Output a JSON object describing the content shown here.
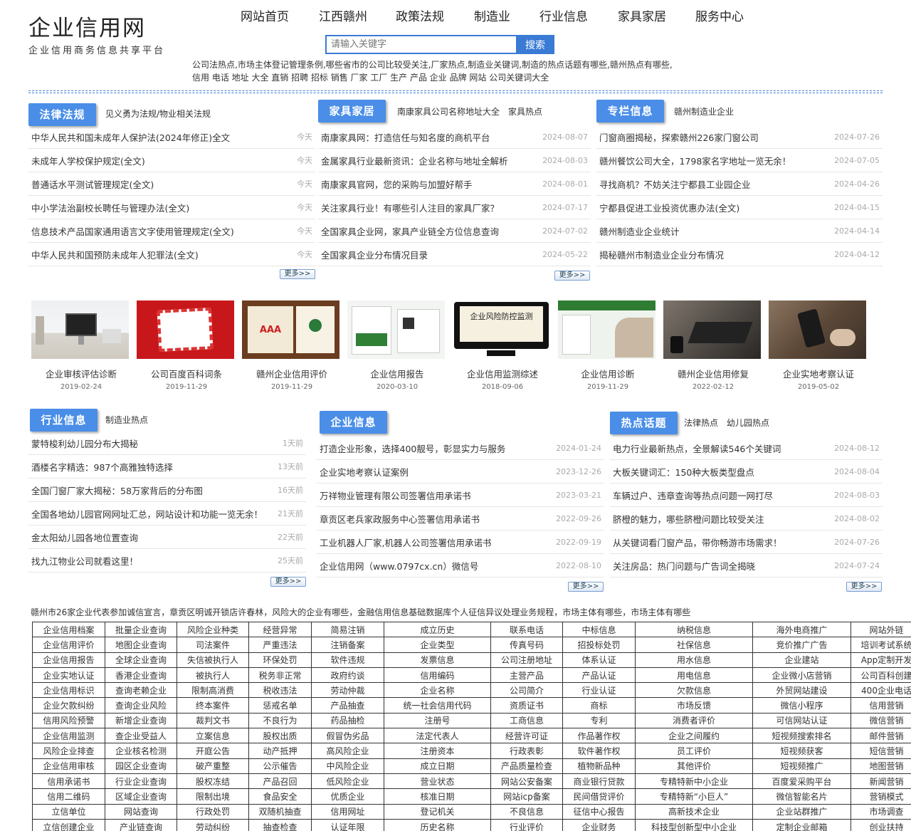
{
  "logo": {
    "title": "企业信用网",
    "subtitle": "企业信用商务信息共享平台"
  },
  "nav": [
    "网站首页",
    "江西赣州",
    "政策法规",
    "制造业",
    "行业信息",
    "家具家居",
    "服务中心"
  ],
  "search": {
    "placeholder": "请输入关键字",
    "button": "搜索"
  },
  "hot_line1": "公司法热点,市场主体登记管理条例,哪些省市的公司比较受关注,厂家热点,制造业关键词,制造的热点话题有哪些,赣州热点有哪些,",
  "hot_line2": "信用 电话 地址 大全 直销 招聘 招标 销售 厂家  工厂 生产 产品 企业 品牌 网站   公司关键词大全",
  "more_label": "更多>>",
  "law": {
    "title": "法律法规",
    "links": [
      "见义勇为法规/物业相关法规"
    ],
    "items": [
      {
        "t": "中华人民共和国未成年人保护法(2024年修正)全文",
        "d": "今天"
      },
      {
        "t": "未成年人学校保护规定(全文)",
        "d": "今天"
      },
      {
        "t": "普通话水平测试管理规定(全文)",
        "d": "今天"
      },
      {
        "t": "中小学法治副校长聘任与管理办法(全文)",
        "d": "今天"
      },
      {
        "t": "信息技术产品国家通用语言文字使用管理规定(全文)",
        "d": "今天"
      },
      {
        "t": "中华人民共和国预防未成年人犯罪法(全文)",
        "d": "今天"
      }
    ]
  },
  "furniture": {
    "title": "家具家居",
    "links": [
      "南康家具公司名称地址大全",
      "家具热点"
    ],
    "items": [
      {
        "t": "南康家具网：打造信任与知名度的商机平台",
        "d": "2024-08-07"
      },
      {
        "t": "金属家具行业最新资讯：企业名称与地址全解析",
        "d": "2024-08-03"
      },
      {
        "t": "南康家具官网，您的采购与加盟好帮手",
        "d": "2024-08-01"
      },
      {
        "t": "关注家具行业！有哪些引人注目的家具厂家？",
        "d": "2024-07-17"
      },
      {
        "t": "全国家具企业网，家具产业链全方位信息查询",
        "d": "2024-07-02"
      },
      {
        "t": "全国家具企业分布情况目录",
        "d": "2024-05-22"
      }
    ]
  },
  "column": {
    "title": "专栏信息",
    "links": [
      "赣州制造业企业"
    ],
    "items": [
      {
        "t": "门窗商圈揭秘，探索赣州226家门窗公司",
        "d": "2024-07-26"
      },
      {
        "t": "赣州餐饮公司大全，1798家名字地址一览无余！",
        "d": "2024-07-05"
      },
      {
        "t": "寻找商机？不妨关注宁都县工业园企业",
        "d": "2024-04-26"
      },
      {
        "t": "宁都县促进工业投资优惠办法(全文)",
        "d": "2024-04-15"
      },
      {
        "t": "赣州制造业企业统计",
        "d": "2024-04-14"
      },
      {
        "t": "揭秘赣州市制造业企业分布情况",
        "d": "2024-04-12"
      }
    ]
  },
  "gallery": [
    {
      "caption": "企业审核评估诊断",
      "date": "2019-02-24"
    },
    {
      "caption": "公司百度百科词条",
      "date": "2019-11-29"
    },
    {
      "caption": "赣州企业信用评价",
      "date": "2019-11-29"
    },
    {
      "caption": "企业信用报告",
      "date": "2020-03-10"
    },
    {
      "caption": "企业信用监测综述",
      "date": "2018-09-06"
    },
    {
      "caption": "企业信用诊断",
      "date": "2019-11-29"
    },
    {
      "caption": "赣州企业信用修复",
      "date": "2022-02-12"
    },
    {
      "caption": "企业实地考察认证",
      "date": "2019-05-02"
    }
  ],
  "gallery_img_text": {
    "risk_title": "企业风险防控监测",
    "aaa": "AAA"
  },
  "industry": {
    "title": "行业信息",
    "links": [
      "制造业热点"
    ],
    "items": [
      {
        "t": "蒙特梭利幼儿园分布大揭秘",
        "d": "1天前"
      },
      {
        "t": "酒楼名字精选：987个高雅独特选择",
        "d": "13天前"
      },
      {
        "t": "全国门窗厂家大揭秘：58万家背后的分布图",
        "d": "16天前"
      },
      {
        "t": "全国各地幼儿园官网网址汇总，网站设计和功能一览无余！",
        "d": "21天前"
      },
      {
        "t": "金太阳幼儿园各地位置查询",
        "d": "22天前"
      },
      {
        "t": "找九江物业公司就看这里！",
        "d": "25天前"
      }
    ]
  },
  "enterprise": {
    "title": "企业信息",
    "links": [],
    "items": [
      {
        "t": "打造企业形象，选择400靓号，彰显实力与服务",
        "d": "2024-01-24"
      },
      {
        "t": "企业实地考察认证案例",
        "d": "2023-12-26"
      },
      {
        "t": "万祥物业管理有限公司签署信用承诺书",
        "d": "2023-03-21"
      },
      {
        "t": "章贡区老兵家政服务中心签署信用承诺书",
        "d": "2022-09-26"
      },
      {
        "t": "工业机器人厂家,机器人公司签署信用承诺书",
        "d": "2022-09-19"
      },
      {
        "t": "企业信用网（www.0797cx.cn）微信号",
        "d": "2022-08-10"
      }
    ]
  },
  "hot": {
    "title": "热点话题",
    "links": [
      "法律热点",
      "幼儿园热点"
    ],
    "items": [
      {
        "t": "电力行业最新热点，全景解读546个关键词",
        "d": "2024-08-12"
      },
      {
        "t": "大板关键词汇：150种大板类型盘点",
        "d": "2024-08-04"
      },
      {
        "t": "车辆过户、违章查询等热点问题一网打尽",
        "d": "2024-08-03"
      },
      {
        "t": "脐橙的魅力，哪些脐橙问题比较受关注",
        "d": "2024-08-02"
      },
      {
        "t": "从关键词看门窗产品，带你畅游市场需求！",
        "d": "2024-07-26"
      },
      {
        "t": "关注房品：热门问题与广告词全揭晓",
        "d": "2024-07-24"
      }
    ]
  },
  "hot_line3": "赣州市26家企业代表参加诚信宣言，章贡区明诚开锁店许春林，风险大的企业有哪些，金融信用信息基础数据库个人征信异议处理业务规程，市场主体有哪些，市场主体有哪些",
  "keywords": [
    [
      "企业信用档案",
      "批量企业查询",
      "风险企业种类",
      "经营异常",
      "简易注销",
      "成立历史",
      "联系电话",
      "中标信息",
      "纳税信息",
      "海外电商推广",
      "网站外链"
    ],
    [
      "企业信用评价",
      "地图企业查询",
      "司法案件",
      "严重违法",
      "注销备案",
      "企业类型",
      "传真号码",
      "招投标处罚",
      "社保信息",
      "竞价推广广告",
      "培训考试系统"
    ],
    [
      "企业信用报告",
      "全球企业查询",
      "失信被执行人",
      "环保处罚",
      "软件违规",
      "发票信息",
      "公司注册地址",
      "体系认证",
      "用水信息",
      "企业建站",
      "App定制开发"
    ],
    [
      "企业实地认证",
      "香港企业查询",
      "被执行人",
      "税务非正常",
      "政府约谈",
      "信用编码",
      "主营产品",
      "产品认证",
      "用电信息",
      "企业微小店营销",
      "公司百科创建"
    ],
    [
      "企业信用标识",
      "查询老赖企业",
      "限制高消费",
      "税收违法",
      "劳动仲裁",
      "企业名称",
      "公司简介",
      "行业认证",
      "欠款信息",
      "外贸网站建设",
      "400企业电话"
    ],
    [
      "企业欠款纠纷",
      "查询企业风险",
      "终本案件",
      "惩戒名单",
      "产品抽查",
      "统一社会信用代码",
      "资质证书",
      "商标",
      "市场反馈",
      "微信小程序",
      "信用营销"
    ],
    [
      "信用风险预警",
      "新增企业查询",
      "裁判文书",
      "不良行为",
      "药品抽检",
      "注册号",
      "工商信息",
      "专利",
      "消费者评价",
      "可信网站认证",
      "微信营销"
    ],
    [
      "企业信用监测",
      "查企业受益人",
      "立案信息",
      "股权出质",
      "假冒伪劣品",
      "法定代表人",
      "经营许可证",
      "作品著作权",
      "企业之间履约",
      "短视频搜索排名",
      "邮件营销"
    ],
    [
      "风险企业排查",
      "企业核名检测",
      "开庭公告",
      "动产抵押",
      "高风险企业",
      "注册资本",
      "行政表彰",
      "软件著作权",
      "员工评价",
      "短视频获客",
      "短信营销"
    ],
    [
      "企业信用审核",
      "园区企业查询",
      "破产重整",
      "公示催告",
      "中风险企业",
      "成立日期",
      "产品质量检查",
      "植物新品种",
      "其他评价",
      "短视频推广",
      "地图营销"
    ],
    [
      "信用承诺书",
      "行业企业查询",
      "股权冻结",
      "产品召回",
      "低风险企业",
      "营业状态",
      "网站公安备案",
      "商业银行贷款",
      "专精特新中小企业",
      "百度爱采购平台",
      "新闻营销"
    ],
    [
      "信用二维码",
      "区域企业查询",
      "限制出境",
      "食品安全",
      "优质企业",
      "核准日期",
      "网站icp备案",
      "民间借贷评价",
      "专精特新“小巨人”",
      "微信智能名片",
      "营销模式"
    ],
    [
      "立信单位",
      "网站查询",
      "行政处罚",
      "双随机抽查",
      "信用网址",
      "登记机关",
      "不良信息",
      "征信中心报告",
      "高新技术企业",
      "企业站群推广",
      "市场调查"
    ],
    [
      "立信创建企业",
      "产业链查询",
      "劳动纠纷",
      "抽查检查",
      "认证年限",
      "历史名称",
      "行业评价",
      "企业财务",
      "科技型创新型中小企业",
      "定制企业邮箱",
      "创业扶持"
    ]
  ]
}
